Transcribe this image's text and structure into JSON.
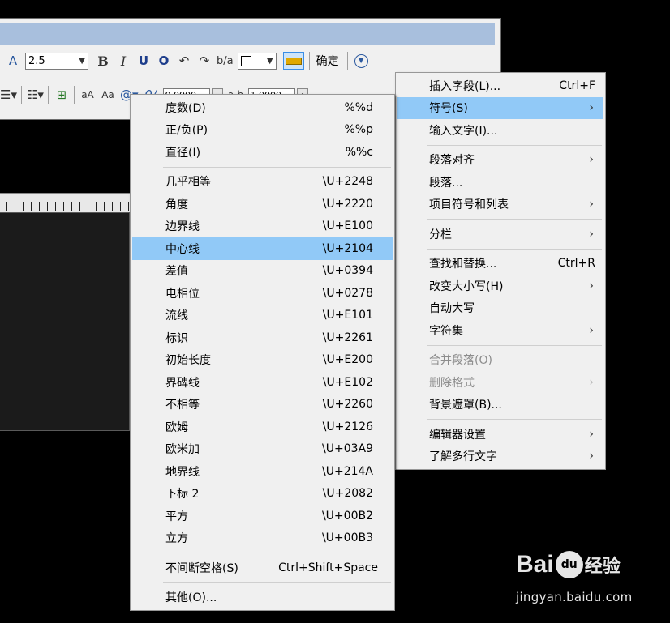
{
  "toolbar": {
    "text_height_value": "2.5",
    "ok_label": "确定",
    "tracking_value": "0.0000",
    "width_value": "1.0000"
  },
  "main_menu": {
    "items": [
      {
        "label": "插入字段(L)...",
        "shortcut": "Ctrl+F"
      },
      {
        "label": "符号(S)",
        "submenu": "›"
      },
      {
        "label": "输入文字(I)..."
      },
      {
        "label": "段落对齐",
        "submenu": "›"
      },
      {
        "label": "段落..."
      },
      {
        "label": "项目符号和列表",
        "submenu": "›"
      },
      {
        "label": "分栏",
        "submenu": "›"
      },
      {
        "label": "查找和替换...",
        "shortcut": "Ctrl+R"
      },
      {
        "label": "改变大小写(H)",
        "submenu": "›"
      },
      {
        "label": "自动大写"
      },
      {
        "label": "字符集",
        "submenu": "›"
      },
      {
        "label": "合并段落(O)"
      },
      {
        "label": "删除格式",
        "submenu": "›"
      },
      {
        "label": "背景遮罩(B)..."
      },
      {
        "label": "编辑器设置",
        "submenu": "›"
      },
      {
        "label": "了解多行文字",
        "submenu": "›"
      }
    ]
  },
  "symbol_menu": {
    "items": [
      {
        "label": "度数(D)",
        "code": "%%d"
      },
      {
        "label": "正/负(P)",
        "code": "%%p"
      },
      {
        "label": "直径(I)",
        "code": "%%c"
      },
      {
        "label": "几乎相等",
        "code": "\\U+2248"
      },
      {
        "label": "角度",
        "code": "\\U+2220"
      },
      {
        "label": "边界线",
        "code": "\\U+E100"
      },
      {
        "label": "中心线",
        "code": "\\U+2104"
      },
      {
        "label": "差值",
        "code": "\\U+0394"
      },
      {
        "label": "电相位",
        "code": "\\U+0278"
      },
      {
        "label": "流线",
        "code": "\\U+E101"
      },
      {
        "label": "标识",
        "code": "\\U+2261"
      },
      {
        "label": "初始长度",
        "code": "\\U+E200"
      },
      {
        "label": "界碑线",
        "code": "\\U+E102"
      },
      {
        "label": "不相等",
        "code": "\\U+2260"
      },
      {
        "label": "欧姆",
        "code": "\\U+2126"
      },
      {
        "label": "欧米加",
        "code": "\\U+03A9"
      },
      {
        "label": "地界线",
        "code": "\\U+214A"
      },
      {
        "label": "下标 2",
        "code": "\\U+2082"
      },
      {
        "label": "平方",
        "code": "\\U+00B2"
      },
      {
        "label": "立方",
        "code": "\\U+00B3"
      },
      {
        "label": "不间断空格(S)",
        "code": "Ctrl+Shift+Space"
      },
      {
        "label": "其他(O)..."
      }
    ]
  },
  "watermark": {
    "brand_left": "Bai",
    "brand_paw": "du",
    "brand_right": "经验",
    "url": "jingyan.baidu.com"
  }
}
